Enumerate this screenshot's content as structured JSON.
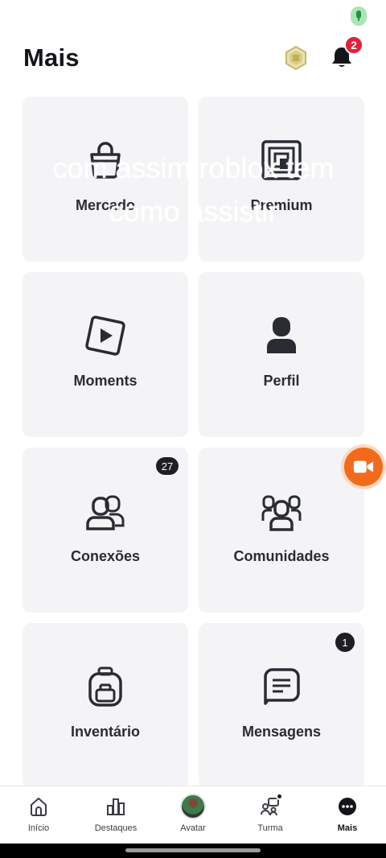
{
  "header": {
    "title": "Mais",
    "notification_count": "2"
  },
  "overlay": {
    "text": "com assim roblox tem como assistir"
  },
  "tiles": [
    {
      "label": "Mercado",
      "badge": ""
    },
    {
      "label": "Premium",
      "badge": ""
    },
    {
      "label": "Moments",
      "badge": ""
    },
    {
      "label": "Perfil",
      "badge": ""
    },
    {
      "label": "Conexões",
      "badge": "27"
    },
    {
      "label": "Comunidades",
      "badge": ""
    },
    {
      "label": "Inventário",
      "badge": ""
    },
    {
      "label": "Mensagens",
      "badge": "1"
    }
  ],
  "bottom_nav": {
    "items": [
      {
        "label": "Início",
        "icon": "home-icon",
        "active": false
      },
      {
        "label": "Destaques",
        "icon": "charts-icon",
        "active": false
      },
      {
        "label": "Avatar",
        "icon": "avatar",
        "active": false
      },
      {
        "label": "Turma",
        "icon": "party-icon",
        "active": false
      },
      {
        "label": "Mais",
        "icon": "more-icon",
        "active": true
      }
    ]
  },
  "colors": {
    "tile_bg": "#f4f4f6",
    "badge_red": "#e3203b",
    "record_orange": "#f26b1d",
    "text_dark": "#141519"
  }
}
